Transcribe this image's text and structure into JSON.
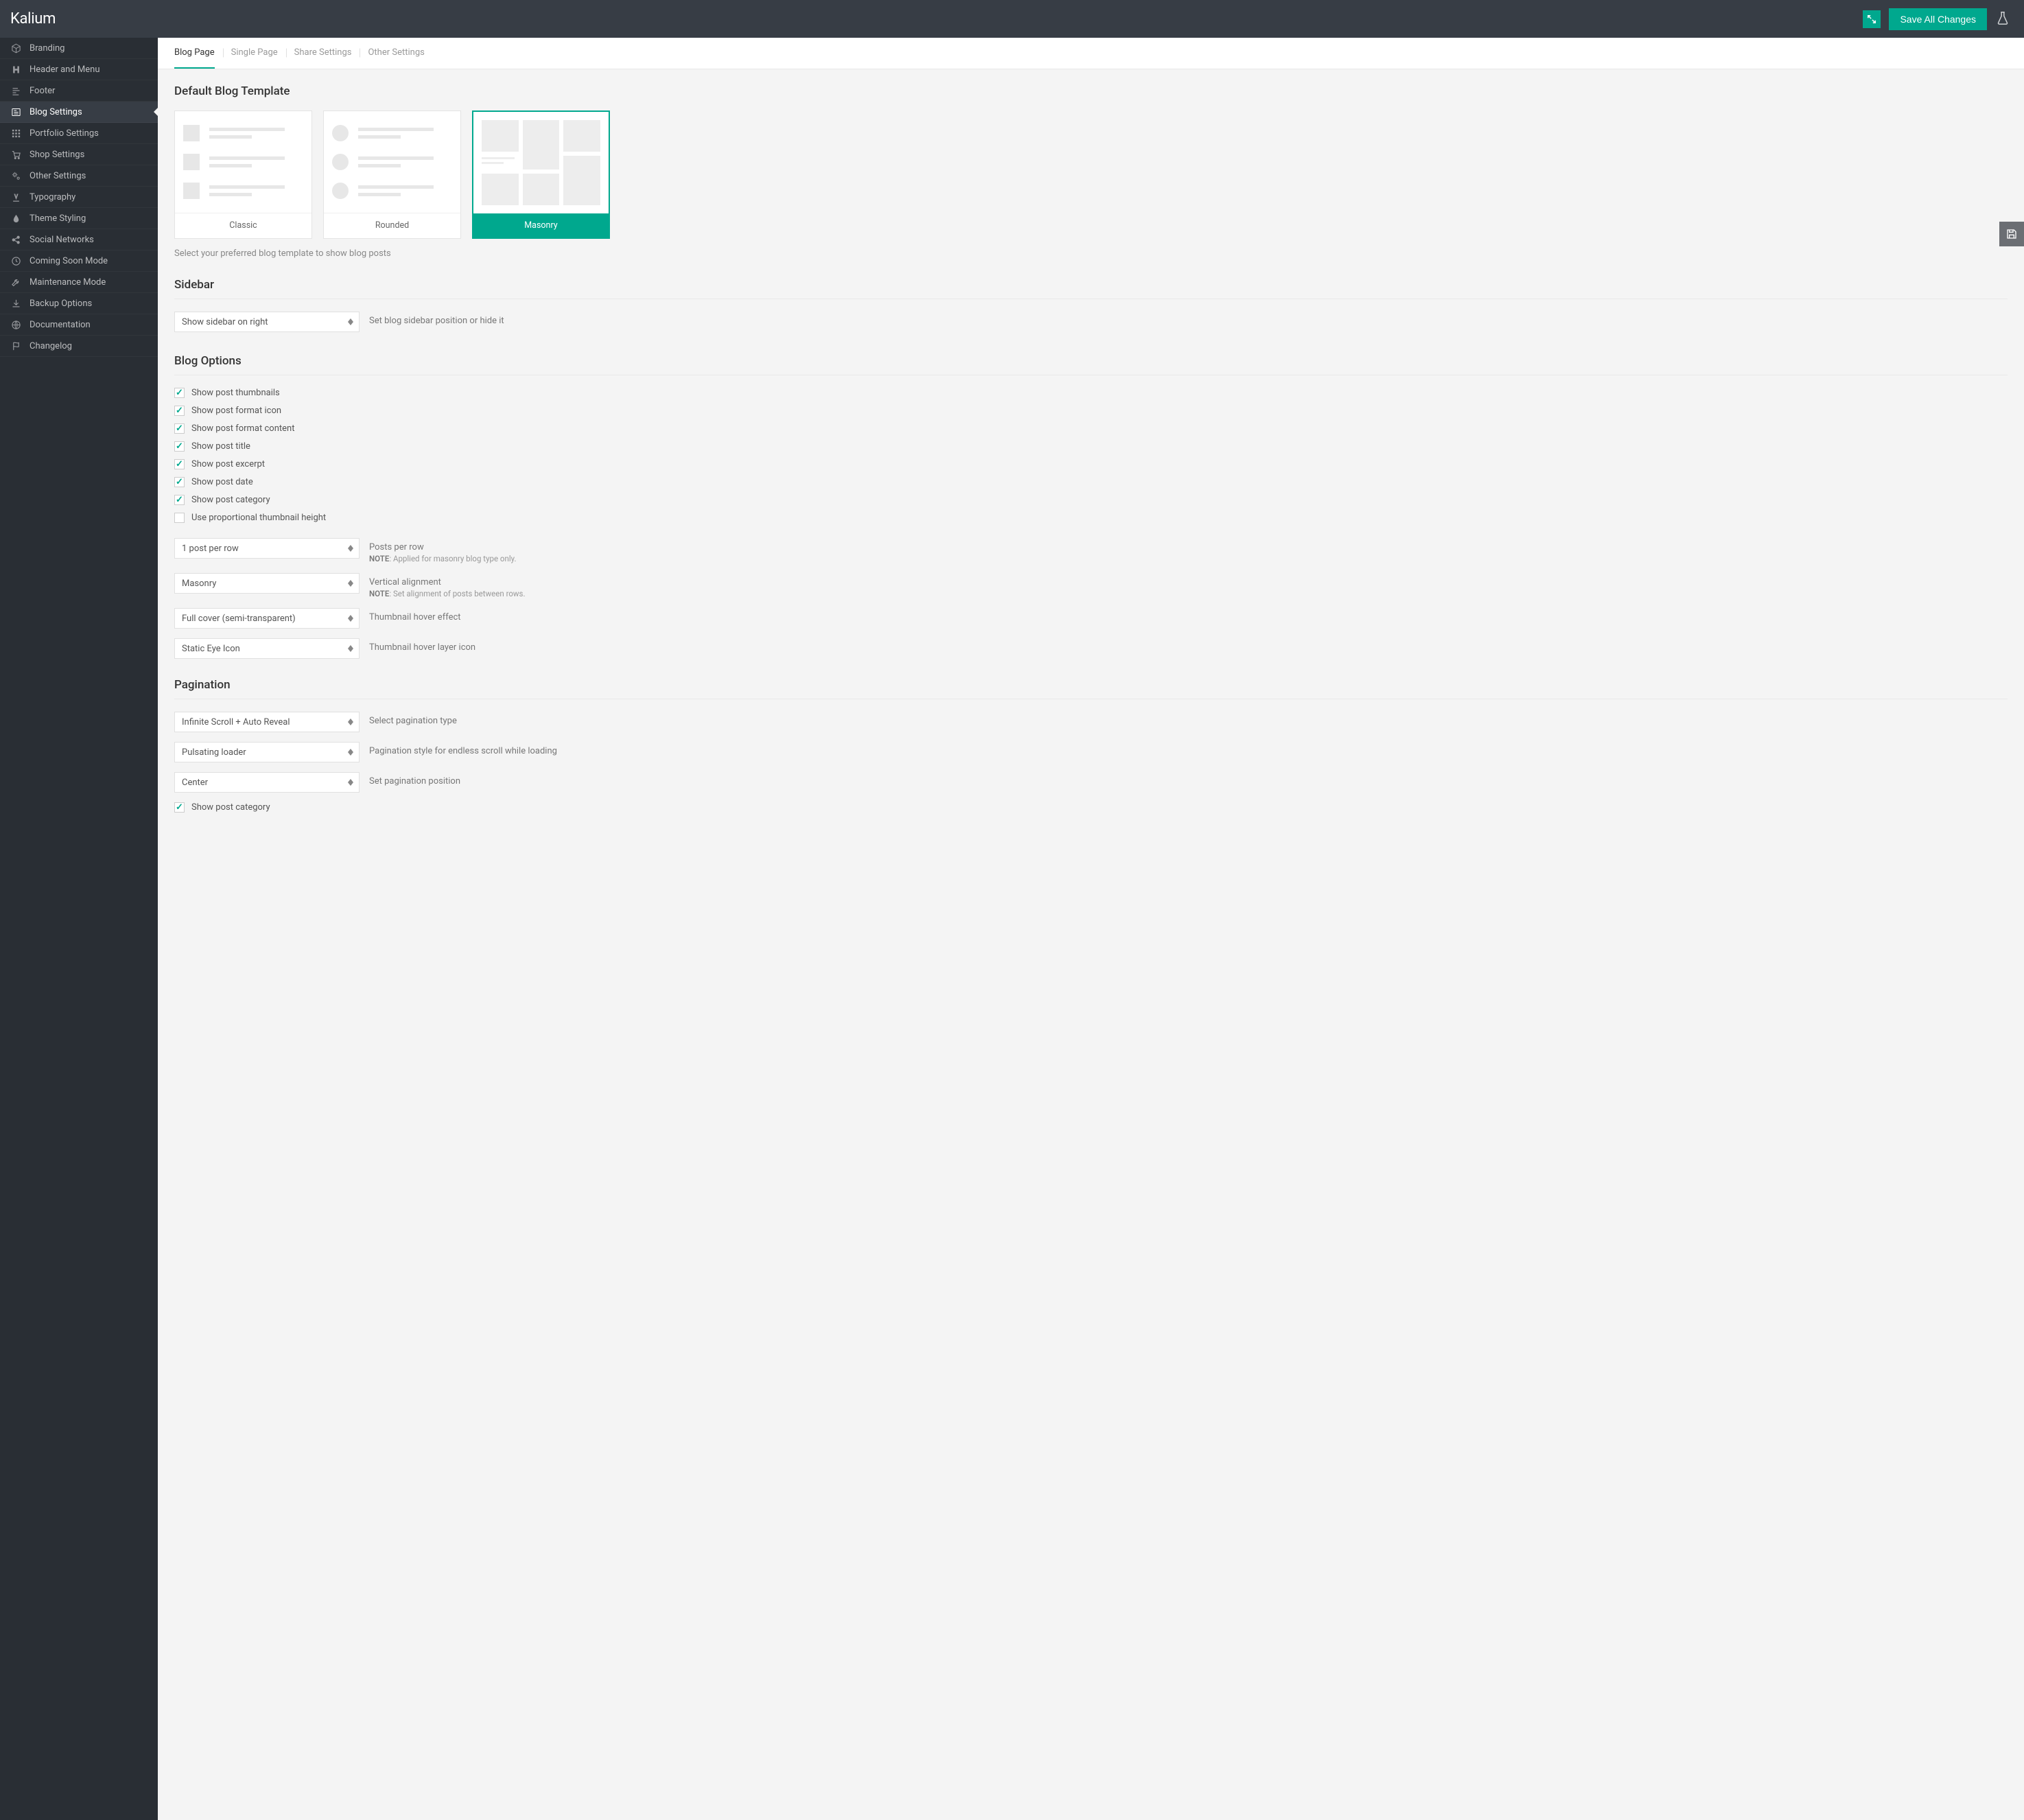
{
  "header": {
    "brand": "Kalium",
    "save_label": "Save All Changes"
  },
  "sidebar": {
    "items": [
      {
        "label": "Branding",
        "icon": "cube"
      },
      {
        "label": "Header and Menu",
        "icon": "header"
      },
      {
        "label": "Footer",
        "icon": "footer"
      },
      {
        "label": "Blog Settings",
        "icon": "blog",
        "active": true
      },
      {
        "label": "Portfolio Settings",
        "icon": "grid"
      },
      {
        "label": "Shop Settings",
        "icon": "cart"
      },
      {
        "label": "Other Settings",
        "icon": "gears"
      },
      {
        "label": "Typography",
        "icon": "type"
      },
      {
        "label": "Theme Styling",
        "icon": "drop"
      },
      {
        "label": "Social Networks",
        "icon": "share"
      },
      {
        "label": "Coming Soon Mode",
        "icon": "clock"
      },
      {
        "label": "Maintenance Mode",
        "icon": "wrench"
      },
      {
        "label": "Backup Options",
        "icon": "download"
      },
      {
        "label": "Documentation",
        "icon": "globe"
      },
      {
        "label": "Changelog",
        "icon": "flag"
      }
    ]
  },
  "tabs": [
    "Blog Page",
    "Single Page",
    "Share Settings",
    "Other Settings"
  ],
  "sections": {
    "template": {
      "title": "Default Blog Template",
      "options": [
        "Classic",
        "Rounded",
        "Masonry"
      ],
      "helper": "Select your preferred blog template to show blog posts"
    },
    "sidebar": {
      "title": "Sidebar",
      "select_value": "Show sidebar on right",
      "helper": "Set blog sidebar position or hide it"
    },
    "blog_options": {
      "title": "Blog Options",
      "checks": [
        {
          "label": "Show post thumbnails",
          "checked": true
        },
        {
          "label": "Show post format icon",
          "checked": true
        },
        {
          "label": "Show post format content",
          "checked": true
        },
        {
          "label": "Show post title",
          "checked": true
        },
        {
          "label": "Show post excerpt",
          "checked": true
        },
        {
          "label": "Show post date",
          "checked": true
        },
        {
          "label": "Show post category",
          "checked": true
        },
        {
          "label": "Use proportional thumbnail height",
          "checked": false
        }
      ],
      "selects": [
        {
          "value": "1 post per row",
          "label": "Posts per row",
          "note": "Applied for masonry blog type only."
        },
        {
          "value": "Masonry",
          "label": "Vertical alignment",
          "note": "Set alignment of posts between rows."
        },
        {
          "value": "Full cover (semi-transparent)",
          "label": "Thumbnail hover effect"
        },
        {
          "value": "Static Eye Icon",
          "label": "Thumbnail hover layer icon"
        }
      ]
    },
    "pagination": {
      "title": "Pagination",
      "selects": [
        {
          "value": "Infinite Scroll + Auto Reveal",
          "label": "Select pagination type"
        },
        {
          "value": "Pulsating loader",
          "label": "Pagination style for endless scroll while loading"
        },
        {
          "value": "Center",
          "label": "Set pagination position"
        }
      ],
      "check": {
        "label": "Show post category",
        "checked": true
      }
    }
  },
  "note_prefix": "NOTE"
}
